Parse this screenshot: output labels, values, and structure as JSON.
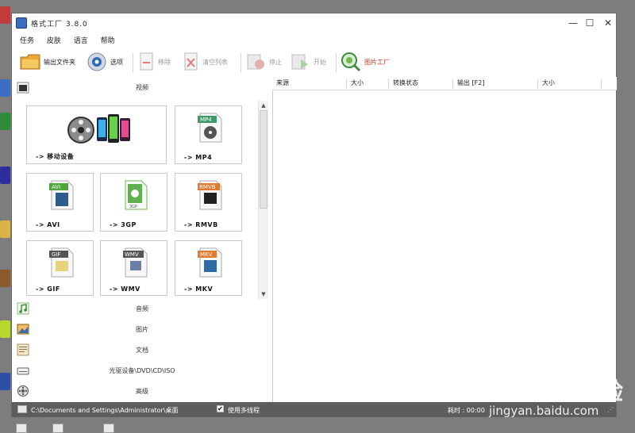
{
  "window": {
    "title": "格式工厂 3.8.0",
    "controls": {
      "minimize": "—",
      "maximize": "☐",
      "close": "✕"
    }
  },
  "menu": [
    "任务",
    "皮肤",
    "语言",
    "帮助"
  ],
  "toolbar": {
    "output_folder": "输出文件夹",
    "options": "选项",
    "remove": "移除",
    "clear_list": "清空列表",
    "stop": "停止",
    "start": "开始",
    "picture_factory": "图片工厂"
  },
  "sidebar": {
    "video_label": "视频",
    "tiles": [
      {
        "label": "-> 移动设备"
      },
      {
        "label": "-> MP4",
        "badge": "MP4",
        "badge_color": "#3f9a6a"
      },
      {
        "label": "-> AVI",
        "badge": "AVI",
        "badge_color": "#4ea73a"
      },
      {
        "label": "-> 3GP",
        "badge": "3GP",
        "badge_color": "#4ea73a"
      },
      {
        "label": "-> RMVB",
        "badge": "RMVB",
        "badge_color": "#e07a2e"
      },
      {
        "label": "-> GIF",
        "badge": "GIF",
        "badge_color": "#555555"
      },
      {
        "label": "-> WMV",
        "badge": "WMV",
        "badge_color": "#555555"
      },
      {
        "label": "-> MKV",
        "badge": "MKV",
        "badge_color": "#e07a2e"
      }
    ],
    "categories": [
      {
        "label": "音频",
        "icon": "music-note-icon"
      },
      {
        "label": "图片",
        "icon": "picture-icon"
      },
      {
        "label": "文档",
        "icon": "document-icon"
      },
      {
        "label": "光驱设备\\DVD\\CD\\ISO",
        "icon": "disc-drive-icon"
      },
      {
        "label": "高级",
        "icon": "advanced-icon"
      }
    ]
  },
  "task_list": {
    "columns": [
      "来源",
      "大小",
      "转换状态",
      "输出 [F2]",
      "大小"
    ]
  },
  "status_bar": {
    "output_path": "C:\\Documents and Settings\\Administrator\\桌面",
    "multithread_label": "使用多线程",
    "multithread_checked": "✔",
    "elapsed": "耗时 : 00:00"
  },
  "watermark": {
    "brand": "Bai du 经验",
    "site": "jingyan.baidu.com"
  }
}
